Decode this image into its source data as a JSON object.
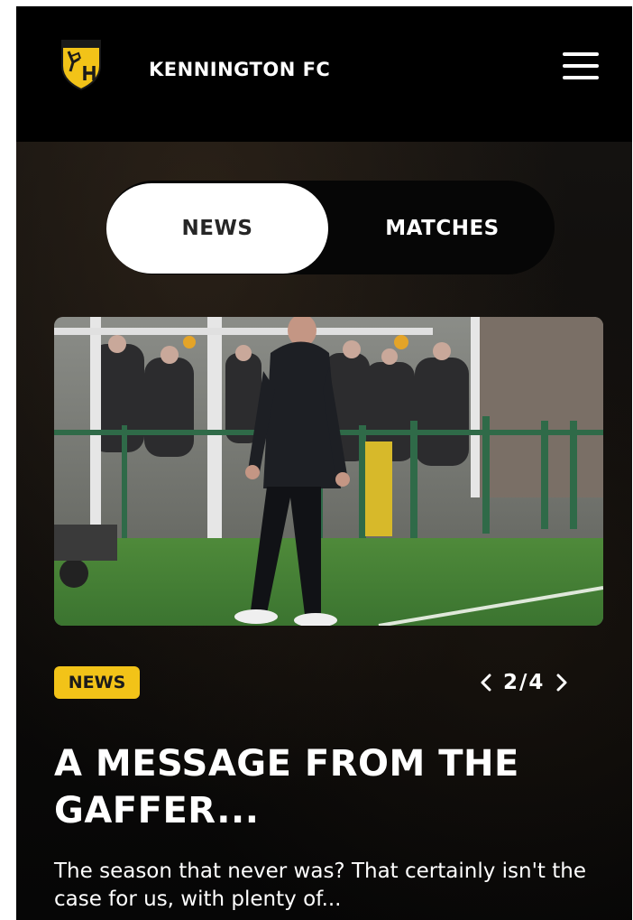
{
  "header": {
    "club_name": "KENNINGTON FC",
    "logo_icon": "club-crest-icon",
    "menu_icon": "hamburger-menu-icon"
  },
  "tabs": [
    {
      "label": "NEWS",
      "active": true
    },
    {
      "label": "MATCHES",
      "active": false
    }
  ],
  "article": {
    "image_icon": "manager-on-pitch-photo",
    "category": "NEWS",
    "pager": {
      "current": 2,
      "total": 4,
      "text": "2/4"
    },
    "headline": "A MESSAGE FROM THE GAFFER...",
    "excerpt": "The season that never was? That certainly isn't the case for us, with plenty of..."
  },
  "colors": {
    "background": "#050505",
    "accent": "#f2c318",
    "active_tab": "#ffffff",
    "text": "#ffffff"
  }
}
